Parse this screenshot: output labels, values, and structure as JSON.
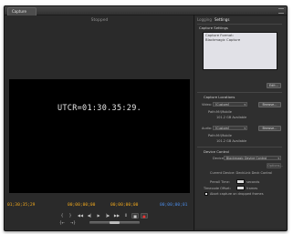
{
  "window": {
    "tab_label": "Capture"
  },
  "monitor": {
    "header": "Stopped",
    "overlay_timecode": "UTCR=01:30.35:29."
  },
  "timecodes": {
    "current": "01;30;35;29",
    "in_point": "00;00;00;00",
    "out_point": "00;00;00;00",
    "duration": "00;00;00;01"
  },
  "transport": {
    "buttons": [
      {
        "icon": "mark-in-icon",
        "glyph": "{"
      },
      {
        "icon": "mark-out-icon",
        "glyph": "}"
      },
      {
        "icon": "rewind-icon",
        "glyph": "◀◀"
      },
      {
        "icon": "step-back-icon",
        "glyph": "◀|"
      },
      {
        "icon": "play-icon",
        "glyph": "▶"
      },
      {
        "icon": "step-forward-icon",
        "glyph": "|▶"
      },
      {
        "icon": "fast-forward-icon",
        "glyph": "▶▶"
      },
      {
        "icon": "pause-icon",
        "glyph": "II"
      },
      {
        "icon": "stop-icon",
        "glyph": "■"
      },
      {
        "icon": "record-icon",
        "glyph": "●"
      }
    ],
    "row2": [
      {
        "icon": "goto-in-icon",
        "glyph": "{←"
      },
      {
        "icon": "goto-out-icon",
        "glyph": "→}"
      }
    ]
  },
  "right_panel": {
    "tabs": [
      "Logging",
      "Settings"
    ],
    "active_tab": "Settings",
    "capture_settings": {
      "title": "Capture Settings",
      "lines": [
        "Capture Format:",
        "Blackmagic Capture"
      ],
      "edit_button": "Edit..."
    },
    "capture_locations": {
      "title": "Capture Locations",
      "video_label": "Video:",
      "video_value": "[Custom]",
      "audio_label": "Audio:",
      "audio_value": "[Custom]",
      "browse_label": "Browse...",
      "path_label": "Path:",
      "path_value": "M:\\Mobile",
      "available": "101.2 GB Available"
    },
    "device_control": {
      "title": "Device Control",
      "device_label": "Device:",
      "device_value": "Blackmagic Device Control",
      "options_button": "Options...",
      "current_device": "Current Device: DeckLink Deck Control",
      "preroll_label": "Preroll Time:",
      "preroll_value": "",
      "preroll_unit": "seconds",
      "timecode_offset_label": "Timecode Offset:",
      "timecode_offset_value": "",
      "timecode_offset_unit": "frames",
      "abort_label": "Abort capture on dropped frames"
    }
  }
}
